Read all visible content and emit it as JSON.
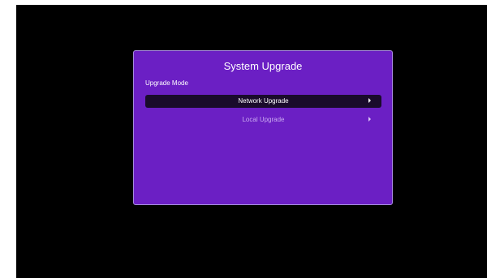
{
  "dialog": {
    "title": "System Upgrade",
    "mode_label": "Upgrade Mode",
    "options": [
      {
        "label": "Network Upgrade",
        "selected": true,
        "icon": "arrow-right-icon"
      },
      {
        "label": "Local Upgrade",
        "selected": false,
        "icon": "arrow-right-icon"
      }
    ]
  },
  "colors": {
    "screen_background": "#000000",
    "dialog_background": "#6b1fc4",
    "dialog_border": "#a88be0",
    "selected_row": "#1a0b2c",
    "text": "#ffffff",
    "dim_text": "#c9a9f0"
  }
}
